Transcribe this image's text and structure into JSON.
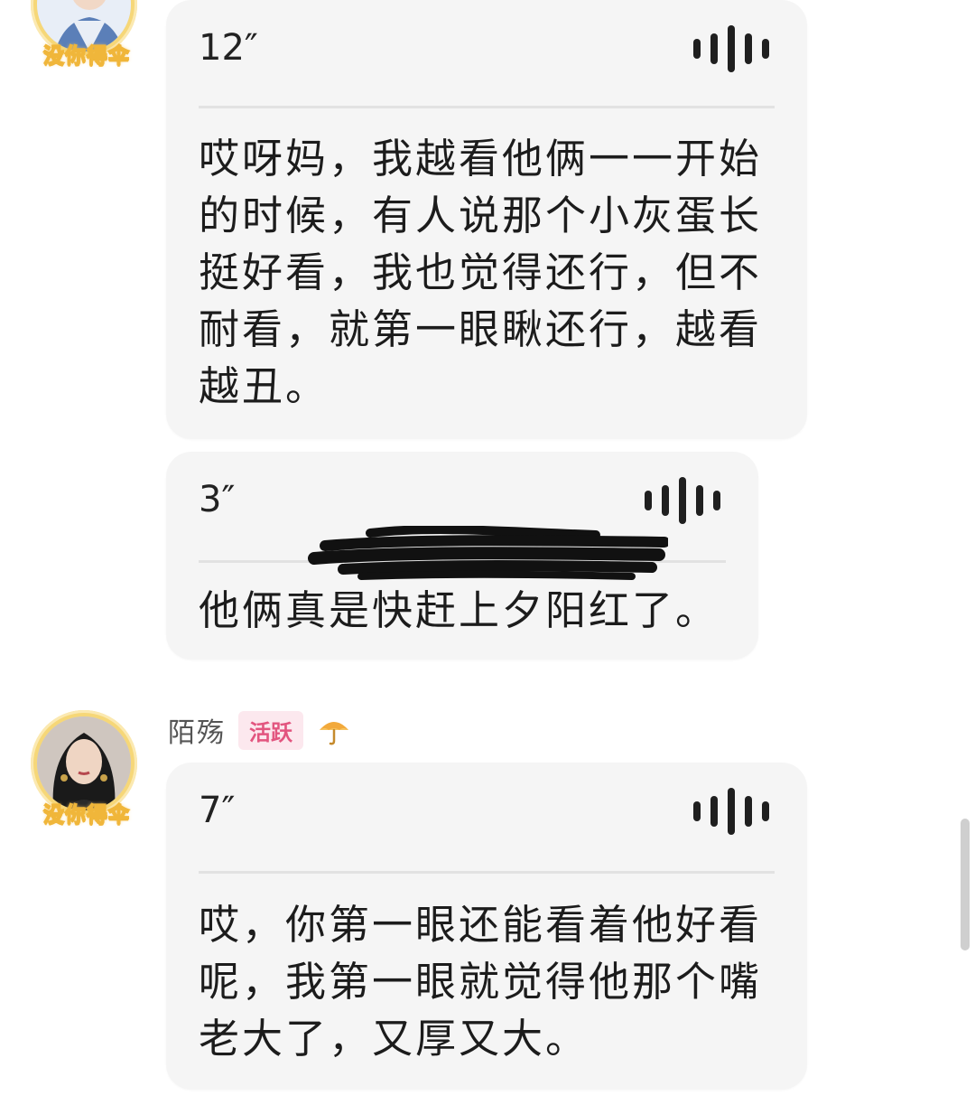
{
  "messages": [
    {
      "duration": "12″",
      "transcript": "哎呀妈，我越看他俩一一开始的时候，有人说那个小灰蛋长挺好看，我也觉得还行，但不耐看，就第一眼瞅还行，越看越丑。"
    },
    {
      "duration": "3″",
      "transcript": "他俩真是快赶上夕阳红了。"
    },
    {
      "duration": "7″",
      "transcript": "哎，你第一眼还能看着他好看呢，我第一眼就觉得他那个嘴老大了，又厚又大。"
    }
  ],
  "avatar_badge_text": "没你得伞",
  "sender": {
    "name": "陌殇",
    "level_tag": "活跃",
    "badge_icon": "umbrella-icon"
  },
  "colors": {
    "bubble_bg": "#f5f5f5",
    "level_tag_bg": "#fce8ee",
    "level_tag_text": "#e2557f",
    "avatar_ring": "#f6d778"
  }
}
